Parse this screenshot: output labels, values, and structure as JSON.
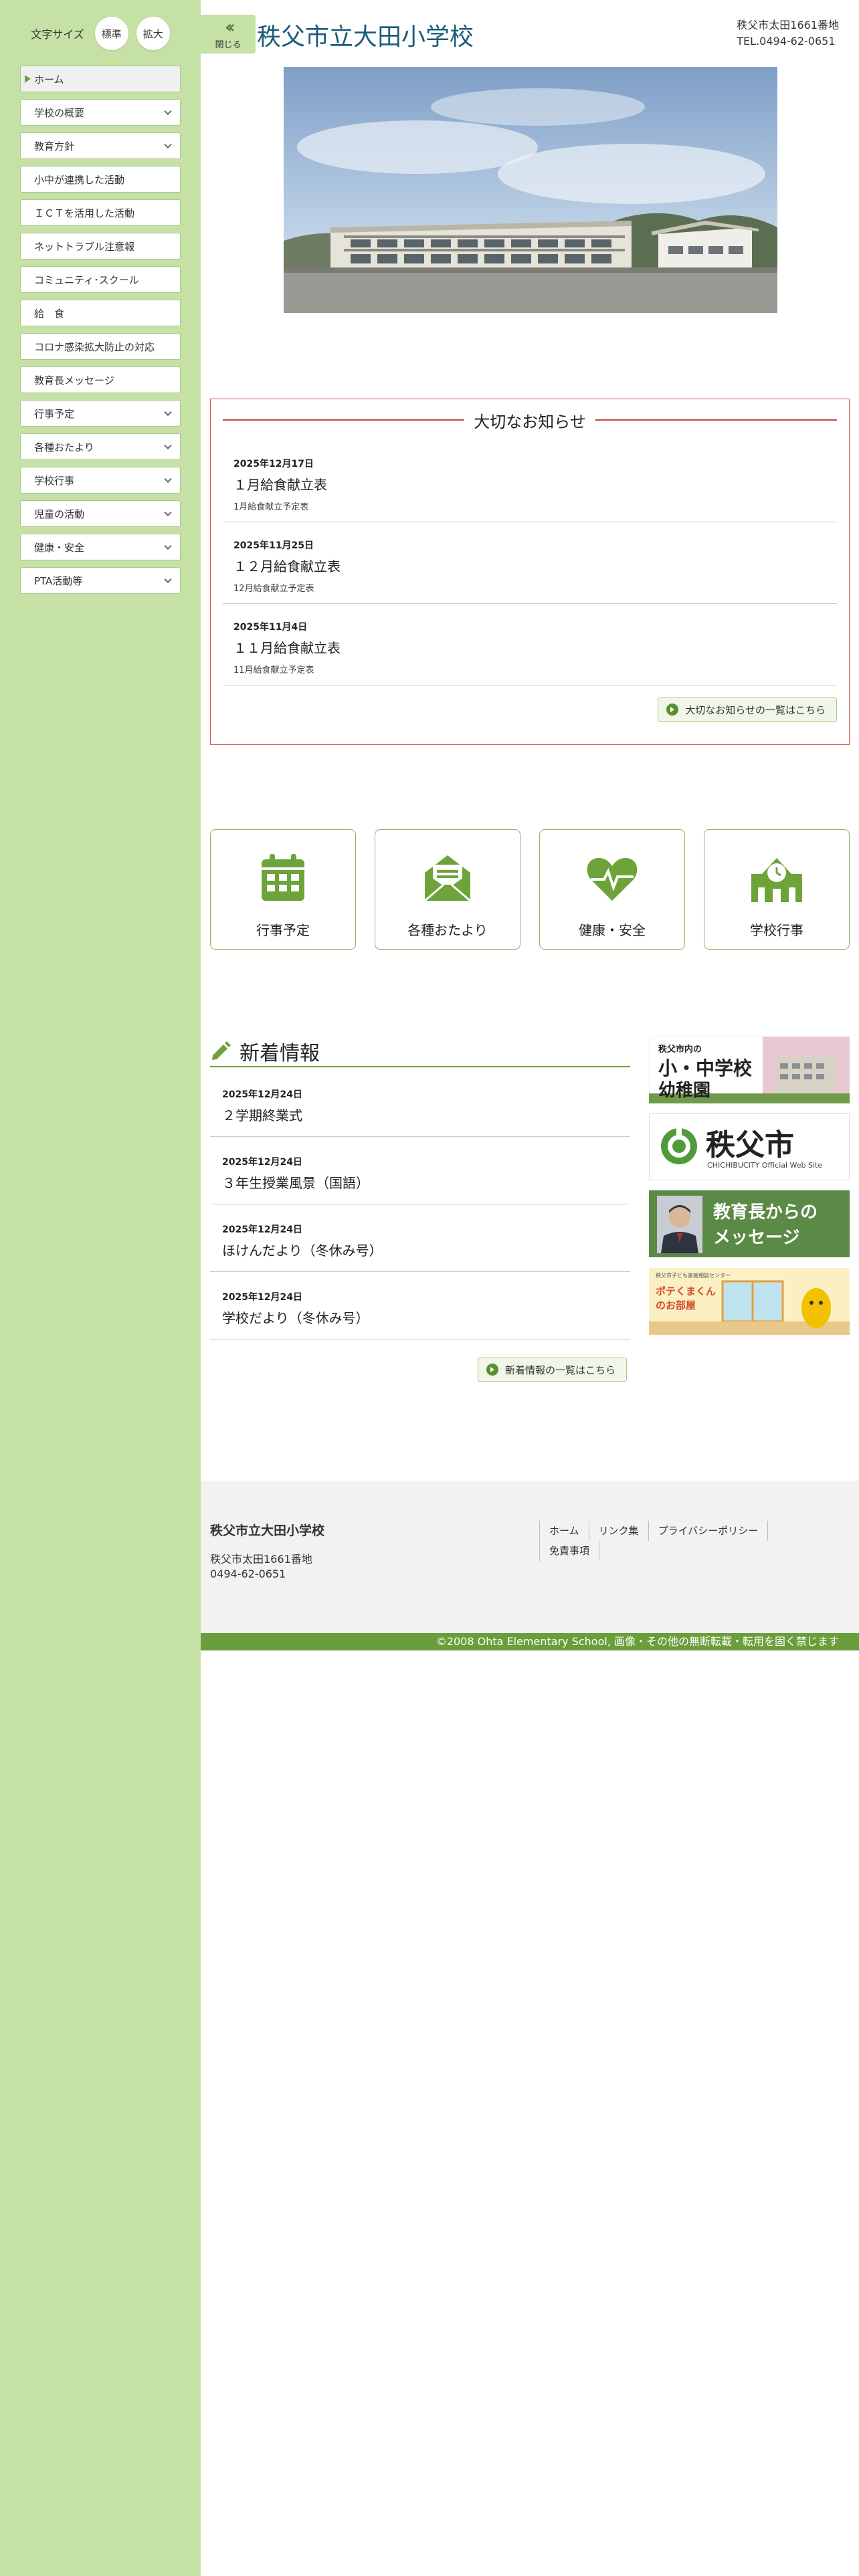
{
  "font_size": {
    "label": "文字サイズ",
    "normal": "標準",
    "large": "拡大"
  },
  "nav": [
    {
      "label": "ホーム",
      "active": true,
      "expandable": false
    },
    {
      "label": "学校の概要",
      "active": false,
      "expandable": true
    },
    {
      "label": "教育方針",
      "active": false,
      "expandable": true
    },
    {
      "label": "小中が連携した活動",
      "active": false,
      "expandable": false
    },
    {
      "label": "ＩＣＴを活用した活動",
      "active": false,
      "expandable": false
    },
    {
      "label": "ネットトラブル注意報",
      "active": false,
      "expandable": false
    },
    {
      "label": "コミュニティ･スクール",
      "active": false,
      "expandable": false
    },
    {
      "label": "給　食",
      "active": false,
      "expandable": false
    },
    {
      "label": "コロナ感染拡大防止の対応",
      "active": false,
      "expandable": false
    },
    {
      "label": "教育長メッセージ",
      "active": false,
      "expandable": false
    },
    {
      "label": "行事予定",
      "active": false,
      "expandable": true
    },
    {
      "label": "各種おたより",
      "active": false,
      "expandable": true
    },
    {
      "label": "学校行事",
      "active": false,
      "expandable": true
    },
    {
      "label": "児童の活動",
      "active": false,
      "expandable": true
    },
    {
      "label": "健康・安全",
      "active": false,
      "expandable": true
    },
    {
      "label": "PTA活動等",
      "active": false,
      "expandable": true
    }
  ],
  "header": {
    "close_label": "閉じる",
    "title": "秩父市立大田小学校",
    "address": "秩父市太田1661番地",
    "tel": "TEL.0494-62-0651"
  },
  "notices": {
    "title": "大切なお知らせ",
    "items": [
      {
        "date": "2025年12月17日",
        "title": "１月給食献立表",
        "sub": "1月給食献立予定表"
      },
      {
        "date": "2025年11月25日",
        "title": "１２月給食献立表",
        "sub": "12月給食献立予定表"
      },
      {
        "date": "2025年11月4日",
        "title": "１１月給食献立表",
        "sub": "11月給食献立予定表"
      }
    ],
    "more": "大切なお知らせの一覧はこちら"
  },
  "quick_links": [
    {
      "label": "行事予定",
      "icon": "calendar-icon"
    },
    {
      "label": "各種おたより",
      "icon": "mail-icon"
    },
    {
      "label": "健康・安全",
      "icon": "heart-pulse-icon"
    },
    {
      "label": "学校行事",
      "icon": "school-clock-icon"
    }
  ],
  "news": {
    "title": "新着情報",
    "items": [
      {
        "date": "2025年12月24日",
        "title": "２学期終業式"
      },
      {
        "date": "2025年12月24日",
        "title": "３年生授業風景（国語）"
      },
      {
        "date": "2025年12月24日",
        "title": "ほけんだより（冬休み号）"
      },
      {
        "date": "2025年12月24日",
        "title": "学校だより（冬休み号）"
      }
    ],
    "more": "新着情報の一覧はこちら"
  },
  "banners": {
    "b1": {
      "line1": "秩父市内の",
      "line2": "小・中学校",
      "line3": "幼稚園"
    },
    "b2": {
      "big": "秩父市",
      "small": "CHICHIBUCITY Official Web Site"
    },
    "b3": {
      "line1": "教育長からの",
      "line2": "メッセージ"
    },
    "b4": {
      "top": "秩父市子ども家庭相談センター",
      "title": "ポテくまくんのお部屋"
    }
  },
  "footer": {
    "name": "秩父市立大田小学校",
    "address": "秩父市太田1661番地",
    "tel": "0494-62-0651",
    "links": [
      "ホーム",
      "リンク集",
      "プライバシーポリシー",
      "免責事項"
    ],
    "copyright": "©2008 Ohta Elementary School, 画像・その他の無断転載・転用を固く禁じます"
  },
  "colors": {
    "sidebar": "#c5e1a5",
    "accent_green": "#6ea33a",
    "notice_red": "#c74444",
    "title_blue": "#1a5c7a"
  }
}
